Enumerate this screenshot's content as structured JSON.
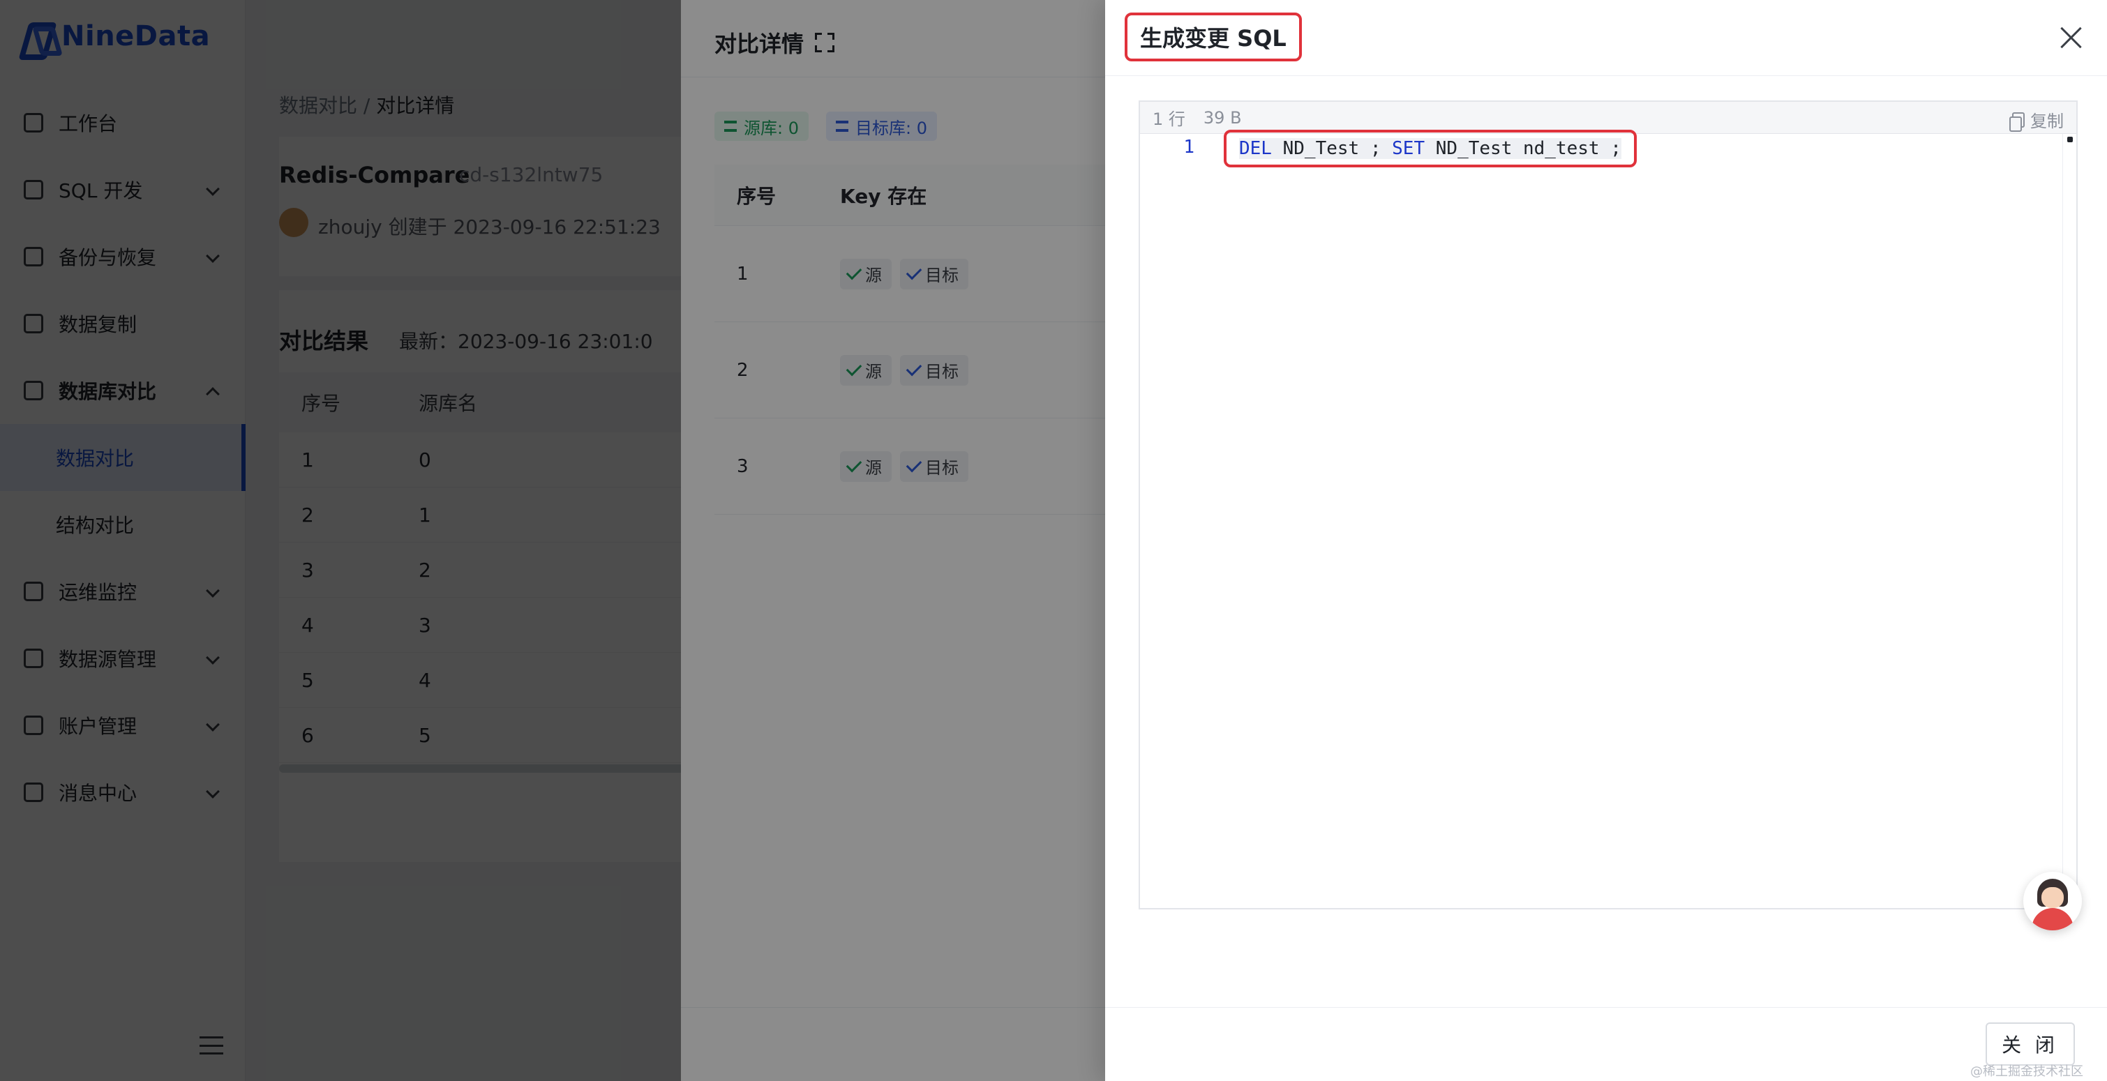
{
  "app": {
    "logo_text": "NineData",
    "brand_color": "#1c4fd8"
  },
  "sidebar": {
    "items": [
      {
        "label": "工作台",
        "icon": "home-icon"
      },
      {
        "label": "SQL 开发",
        "icon": "monitor-icon"
      },
      {
        "label": "备份与恢复",
        "icon": "cloud-backup-icon"
      },
      {
        "label": "数据复制",
        "icon": "copy-data-icon"
      },
      {
        "label": "数据库对比",
        "icon": "compare-icon"
      },
      {
        "label": "运维监控",
        "icon": "alarm-icon"
      },
      {
        "label": "数据源管理",
        "icon": "datasource-icon"
      },
      {
        "label": "账户管理",
        "icon": "account-icon"
      },
      {
        "label": "消息中心",
        "icon": "mail-icon"
      }
    ],
    "subitems": [
      "数据对比",
      "结构对比"
    ]
  },
  "breadcrumb": {
    "parent": "数据对比",
    "separator": "/",
    "current": "对比详情"
  },
  "task": {
    "title": "Redis-Compare",
    "id": "cd-s132lntw75",
    "creator": "zhoujy 创建于 2023-09-16 22:51:23"
  },
  "result": {
    "title": "对比结果",
    "latest": "最新：2023-09-16 23:01:0",
    "headers": [
      "序号",
      "源库名"
    ],
    "rows": [
      [
        "1",
        "0"
      ],
      [
        "2",
        "1"
      ],
      [
        "3",
        "2"
      ],
      [
        "4",
        "3"
      ],
      [
        "5",
        "4"
      ],
      [
        "6",
        "5"
      ]
    ]
  },
  "detail_drawer": {
    "title": "对比详情",
    "source_tag": "源库: 0",
    "target_tag": "目标库: 0",
    "headers": [
      "序号",
      "Key 存在"
    ],
    "rows": [
      {
        "no": "1",
        "src": "源",
        "tgt": "目标"
      },
      {
        "no": "2",
        "src": "源",
        "tgt": "目标"
      },
      {
        "no": "3",
        "src": "源",
        "tgt": "目标"
      }
    ]
  },
  "sql_drawer": {
    "title": "生成变更 SQL",
    "line_info": "1 行",
    "size_info": "39 B",
    "copy_label": "复制",
    "line_number": "1",
    "code": {
      "kw1": "DEL",
      "part1": " ND_Test ; ",
      "kw2": "SET",
      "part2": " ND_Test nd_test ;"
    },
    "close_label": "关 闭",
    "highlight_color": "#e0323b"
  },
  "watermark": "@稀土掘金技术社区"
}
